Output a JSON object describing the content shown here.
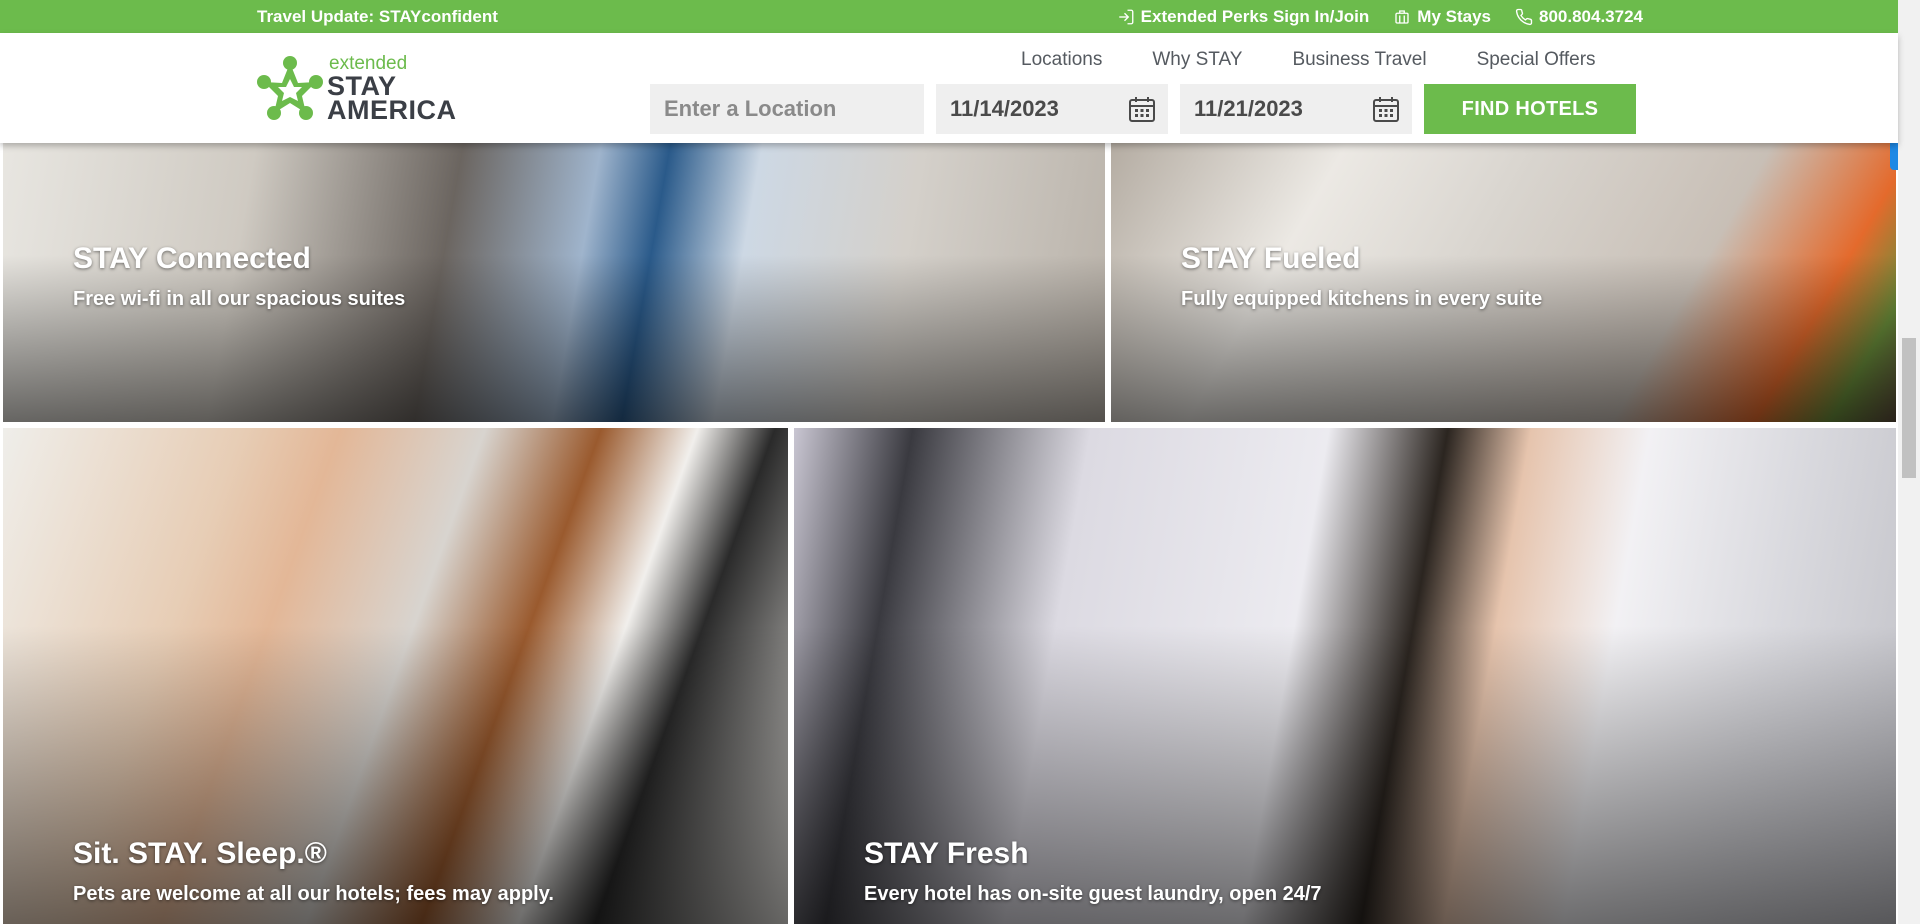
{
  "topbar": {
    "travel_update": "Travel Update: STAYconfident",
    "perks": "Extended Perks Sign In/Join",
    "my_stays": "My Stays",
    "phone": "800.804.3724"
  },
  "logo": {
    "line1": "extended",
    "line2": "STAY",
    "line3": "AMERICA"
  },
  "nav": {
    "items": [
      "Locations",
      "Why STAY",
      "Business Travel",
      "Special Offers"
    ]
  },
  "search": {
    "location_placeholder": "Enter a Location",
    "checkin": "11/14/2023",
    "checkout": "11/21/2023",
    "find_label": "FIND HOTELS"
  },
  "tiles": [
    {
      "title": "STAY Connected",
      "subtitle": "Free wi-fi in all our spacious suites"
    },
    {
      "title": "STAY Fueled",
      "subtitle": "Fully equipped kitchens in every suite"
    },
    {
      "title": "Sit. STAY. Sleep.®",
      "subtitle": "Pets are welcome at all our hotels; fees may apply."
    },
    {
      "title": "STAY Fresh",
      "subtitle": "Every hotel has on-site guest laundry, open 24/7"
    }
  ],
  "colors": {
    "brand_green": "#6cbb4c",
    "text_dark": "#3b3f46"
  }
}
